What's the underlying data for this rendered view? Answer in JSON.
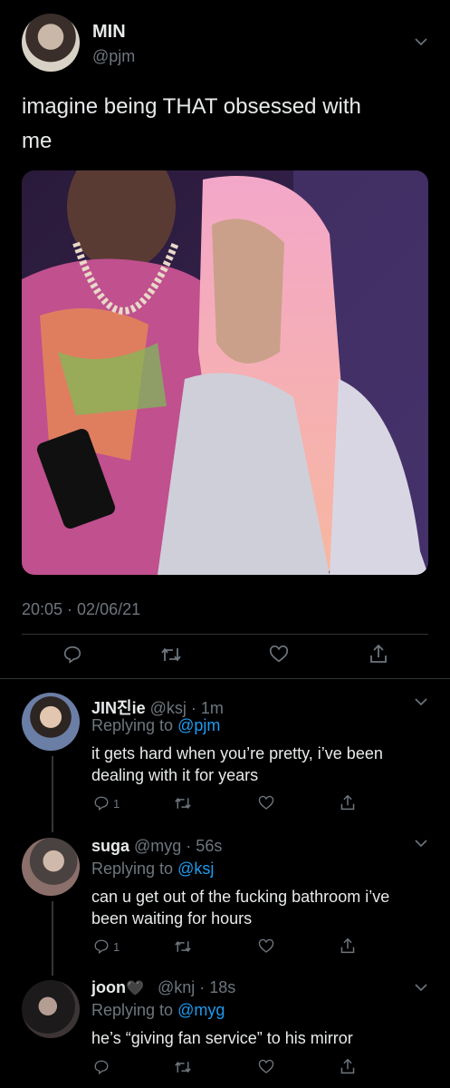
{
  "tweet": {
    "name": "MIN",
    "handle": "@pjm",
    "text_line1": "imagine being THAT obsessed with",
    "text_line2": "me",
    "timestamp": "20:05 · 02/06/21"
  },
  "replies": [
    {
      "name": "JIN진ie",
      "handle_time": "@ksj · 1m",
      "replying_prefix": "Replying to",
      "replying_to": "@pjm",
      "text_line1": "it gets hard when you’re pretty, i’ve been",
      "text_line2": "dealing with it for years",
      "reply_count": "1"
    },
    {
      "name": "suga",
      "handle_time": "@myg · 56s",
      "replying_prefix": "Replying to",
      "replying_to": "@ksj",
      "text_line1": "can u get out of the fucking bathroom i’ve",
      "text_line2": "been waiting for hours",
      "reply_count": "1"
    },
    {
      "name": "joon",
      "name_emoji": "🖤",
      "handle_time": "@knj · 18s",
      "replying_prefix": "Replying to",
      "replying_to": "@myg",
      "text_line1": "he’s “giving fan service” to his mirror"
    }
  ],
  "icons": [
    "reply-icon",
    "retweet-icon",
    "like-icon",
    "share-icon",
    "chevron-down-icon"
  ],
  "colors": {
    "background": "#000000",
    "link": "#1d9bf0",
    "muted": "#6e767d",
    "divider": "#2f3336"
  }
}
